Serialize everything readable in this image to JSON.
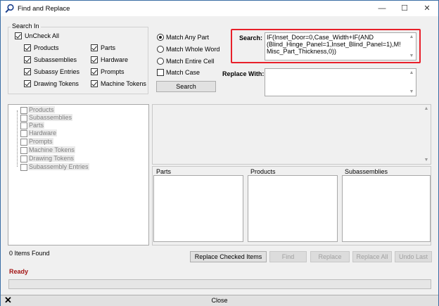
{
  "window": {
    "title": "Find and Replace",
    "minimize_glyph": "—",
    "maximize_glyph": "☐",
    "close_glyph": "✕"
  },
  "search_in": {
    "group_label": "Search In",
    "uncheck_all": {
      "label": "UnCheck All",
      "checked": true
    },
    "options": [
      {
        "label": "Products",
        "checked": true
      },
      {
        "label": "Parts",
        "checked": true
      },
      {
        "label": "Subassemblies",
        "checked": true
      },
      {
        "label": "Hardware",
        "checked": true
      },
      {
        "label": "Subassy Entries",
        "checked": true
      },
      {
        "label": "Prompts",
        "checked": true
      },
      {
        "label": "Drawing Tokens",
        "checked": true
      },
      {
        "label": "Machine Tokens",
        "checked": true
      }
    ]
  },
  "match_options": {
    "match_any_part": "Match Any Part",
    "match_whole_word": "Match Whole Word",
    "match_entire_cell": "Match Entire Cell",
    "match_case": "Match Case",
    "selected": "Match Any Part"
  },
  "search_button": "Search",
  "search_field": {
    "label": "Search:",
    "value_line1": "IF(Inset_Door=0,Case_Width+IF(AND",
    "value_line2": "(Blind_Hinge_Panel=1,Inset_Blind_Panel=1),M!",
    "value_line3": "Misc_Part_Thickness,0))"
  },
  "replace_field": {
    "label": "Replace With:",
    "value": ""
  },
  "tree": {
    "items": [
      "Products",
      "Subassemblies",
      "Parts",
      "Hardware",
      "Prompts",
      "Machine Tokens",
      "Drawing Tokens",
      "Subassembly Entries"
    ]
  },
  "result_panels": {
    "parts": "Parts",
    "products": "Products",
    "subassemblies": "Subassemblies"
  },
  "status": {
    "items_found": "0 Items Found",
    "state": "Ready",
    "state_color": "#a31515",
    "progress": 0
  },
  "buttons": {
    "replace_checked": "Replace Checked Items",
    "find": "Find",
    "replace": "Replace",
    "replace_all": "Replace All",
    "undo_last": "Undo Last"
  },
  "close_bar": {
    "label": "Close",
    "icon_glyph": "✕"
  },
  "colors": {
    "highlight_border": "#e8202a",
    "window_border": "#3a6ea5"
  }
}
